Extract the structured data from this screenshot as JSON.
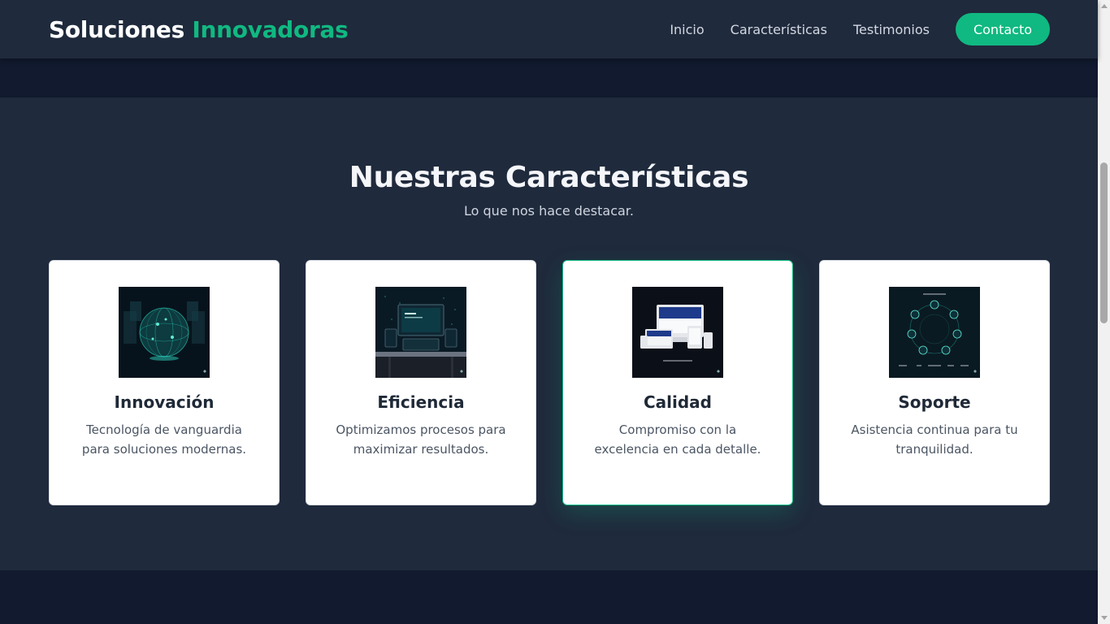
{
  "header": {
    "logo_text": "Soluciones",
    "logo_accent": "Innovadoras",
    "nav": [
      {
        "label": "Inicio"
      },
      {
        "label": "Características"
      },
      {
        "label": "Testimonios"
      }
    ],
    "cta_label": "Contacto"
  },
  "features": {
    "title": "Nuestras Características",
    "subtitle": "Lo que nos hace destacar.",
    "cards": [
      {
        "title": "Innovación",
        "description": "Tecnología de vanguardia para soluciones modernas.",
        "image": "globe-network-image"
      },
      {
        "title": "Eficiencia",
        "description": "Optimizamos procesos para maximizar resultados.",
        "image": "workstation-devices-image"
      },
      {
        "title": "Calidad",
        "description": "Compromiso con la excelencia en cada detalle.",
        "image": "responsive-devices-image"
      },
      {
        "title": "Soporte",
        "description": "Asistencia continua para tu tranquilidad.",
        "image": "technology-circle-image"
      }
    ]
  },
  "colors": {
    "accent": "#10b981",
    "nav_bg": "#1f2a3c",
    "page_bg": "#111a2e",
    "card_bg": "#ffffff"
  }
}
